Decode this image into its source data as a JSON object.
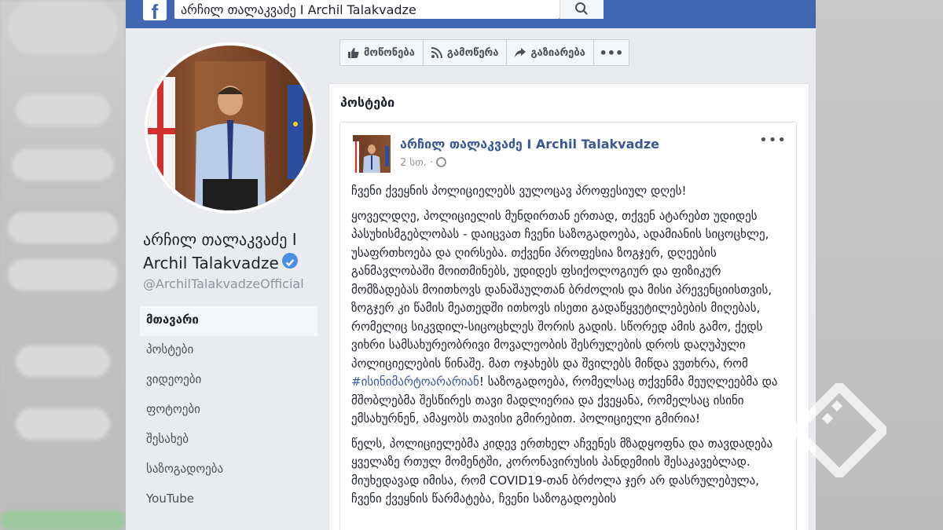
{
  "topbar": {
    "logo": "f",
    "search_value": "არჩილ თალაკვაძე I Archil Talakvadze"
  },
  "profile": {
    "name_line1": "არჩილ თალაკვაძე I",
    "name_line2": "Archil Talakvadze",
    "handle": "@ArchilTalakvadzeOfficial"
  },
  "nav": [
    {
      "label": "მთავარი",
      "active": true
    },
    {
      "label": "პოსტები"
    },
    {
      "label": "ვიდეოები"
    },
    {
      "label": "ფოტოები"
    },
    {
      "label": "შესახებ"
    },
    {
      "label": "საზოგადოება"
    },
    {
      "label": "YouTube"
    }
  ],
  "actions": {
    "like": "მოწონება",
    "follow": "გამოწერა",
    "share": "გაზიარება",
    "more": "•••"
  },
  "posts": {
    "title": "პოსტები",
    "author": "არჩილ თალაკვაძე I Archil Talakvadze",
    "time": "2 სთ. ·",
    "menu": "•••",
    "p1": "ჩვენი ქვეყნის პოლიციელებს ვულოცავ პროფესიულ დღეს!",
    "p2": "ყოველდღე, პოლიციელის მუნდირთან ერთად, თქვენ ატარებთ უდიდეს პასუხისმგებლობას - დაიცვათ ჩვენი საზოგადოება, ადამიანის სიცოცხლე, უსაფრთხოება და ღირსება. თქვენი პროფესია ზოგჯერ, დღეების განმავლობაში მოითმინებს, უდიდეს ფსიქოლოგიურ და ფიზიკურ მომზადებას მოითხოვს დანაშაულთან ბრძოლის და მისი პრევენციისთვის, ზოგჯერ კი წამის მეათედში ითხოვს ისეთი გადაწყვეტილებების მიღებას, რომელიც სიკვდილ-სიცოცხლეს შორის გადის. სწორედ ამის გამო, ქედს ვიხრი სამსახურეობრივი მოვალეობის შესრულების დროს დაღუპული პოლიციელების წინაშე. მათ ოჯახებს და შვილებს მიწდა ვუთხრა, რომ",
    "hashtag": "#ისინიმარტოარარიან",
    "p2_end": "! საზოგადოება, რომელსაც თქვენმა მეუღლეებმა და მშობლებმა შესწირეს თავი მადლიერია და ქვეყანა, რომელსაც ისინი ემსახურნენ, ამაყობს თავისი გმირებით. პოლიციელი გმირია!",
    "p3": "წელს, პოლიციელებმა კიდევ ერთხელ აჩვენეს მზადყოფნა და თავდადება ყველაზე რთულ მომენტში, კორონავირუსის პანდემიის შესაკავებლად. მიუხედავად იმისა, რომ COVID19-თან ბრძოლა ჯერ არ დასრულებულა, ჩვენი ქვეყნის წარმატება, ჩვენი საზოგადოების"
  },
  "colors": {
    "facebook_blue": "#4267b2",
    "link_blue": "#385898",
    "verified_blue": "#4a90e2"
  }
}
